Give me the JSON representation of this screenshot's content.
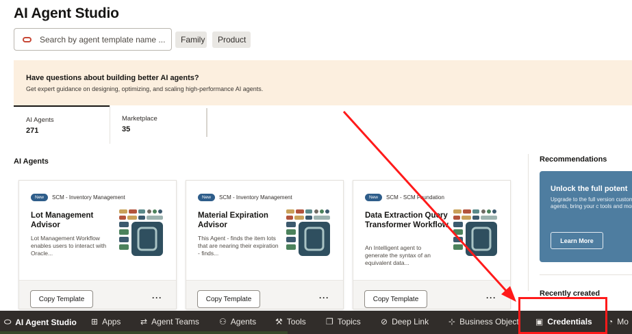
{
  "page": {
    "title": "AI Agent Studio"
  },
  "search": {
    "placeholder": "Search by agent template name ..."
  },
  "filters": [
    {
      "label": "Family"
    },
    {
      "label": "Product"
    }
  ],
  "banner": {
    "heading": "Have questions about building better AI agents?",
    "subtext": "Get expert guidance on designing, optimizing, and scaling high-performance AI agents."
  },
  "tabs": [
    {
      "label": "AI Agents",
      "count": "271",
      "selected": true
    },
    {
      "label": "Marketplace",
      "count": "35",
      "selected": false
    }
  ],
  "section": {
    "title": "AI Agents"
  },
  "cards": [
    {
      "badge": "New",
      "category": "SCM - Inventory Management",
      "name": "Lot Management Advisor",
      "description": "Lot Management Workflow enables users to interact with Oracle...",
      "copy_label": "Copy Template",
      "more_label": "···"
    },
    {
      "badge": "New",
      "category": "SCM - Inventory Management",
      "name": "Material Expiration Advisor",
      "description": "This Agent - finds the item lots that are nearing their expiration - finds...",
      "copy_label": "Copy Template",
      "more_label": "···"
    },
    {
      "badge": "New",
      "category": "SCM - SCM Foundation",
      "name": "Data Extraction Query Transformer Workflow",
      "description": "An Intelligent agent to generate the syntax of an equivalent data...",
      "copy_label": "Copy Template",
      "more_label": "···"
    }
  ],
  "recommendations": {
    "title": "Recommendations",
    "promo_heading": "Unlock the full potent",
    "promo_text": "Upgrade to the full version custom agents, bring your c tools and more.",
    "learn_more": "Learn More",
    "recently_created": "Recently created"
  },
  "taskbar": {
    "items": [
      {
        "label": "AI Agent Studio",
        "icon": "oracle-ring-icon"
      },
      {
        "label": "Apps",
        "icon": "apps-grid-icon"
      },
      {
        "label": "Agent Teams",
        "icon": "agent-teams-icon"
      },
      {
        "label": "Agents",
        "icon": "agents-icon"
      },
      {
        "label": "Tools",
        "icon": "tools-icon"
      },
      {
        "label": "Topics",
        "icon": "topics-icon"
      },
      {
        "label": "Deep Link",
        "icon": "link-icon"
      },
      {
        "label": "Business Object",
        "icon": "business-object-icon"
      },
      {
        "label": "Credentials",
        "icon": "credentials-icon",
        "highlighted": true
      },
      {
        "label": "Mo",
        "icon": "monitor-icon"
      }
    ]
  },
  "colors": {
    "accent_red": "#c74634",
    "banner_bg": "#fcefdf",
    "taskbar_bg": "#312d2a",
    "promo_bg": "#4e7da0",
    "annotation_red": "#ff1a1a"
  }
}
